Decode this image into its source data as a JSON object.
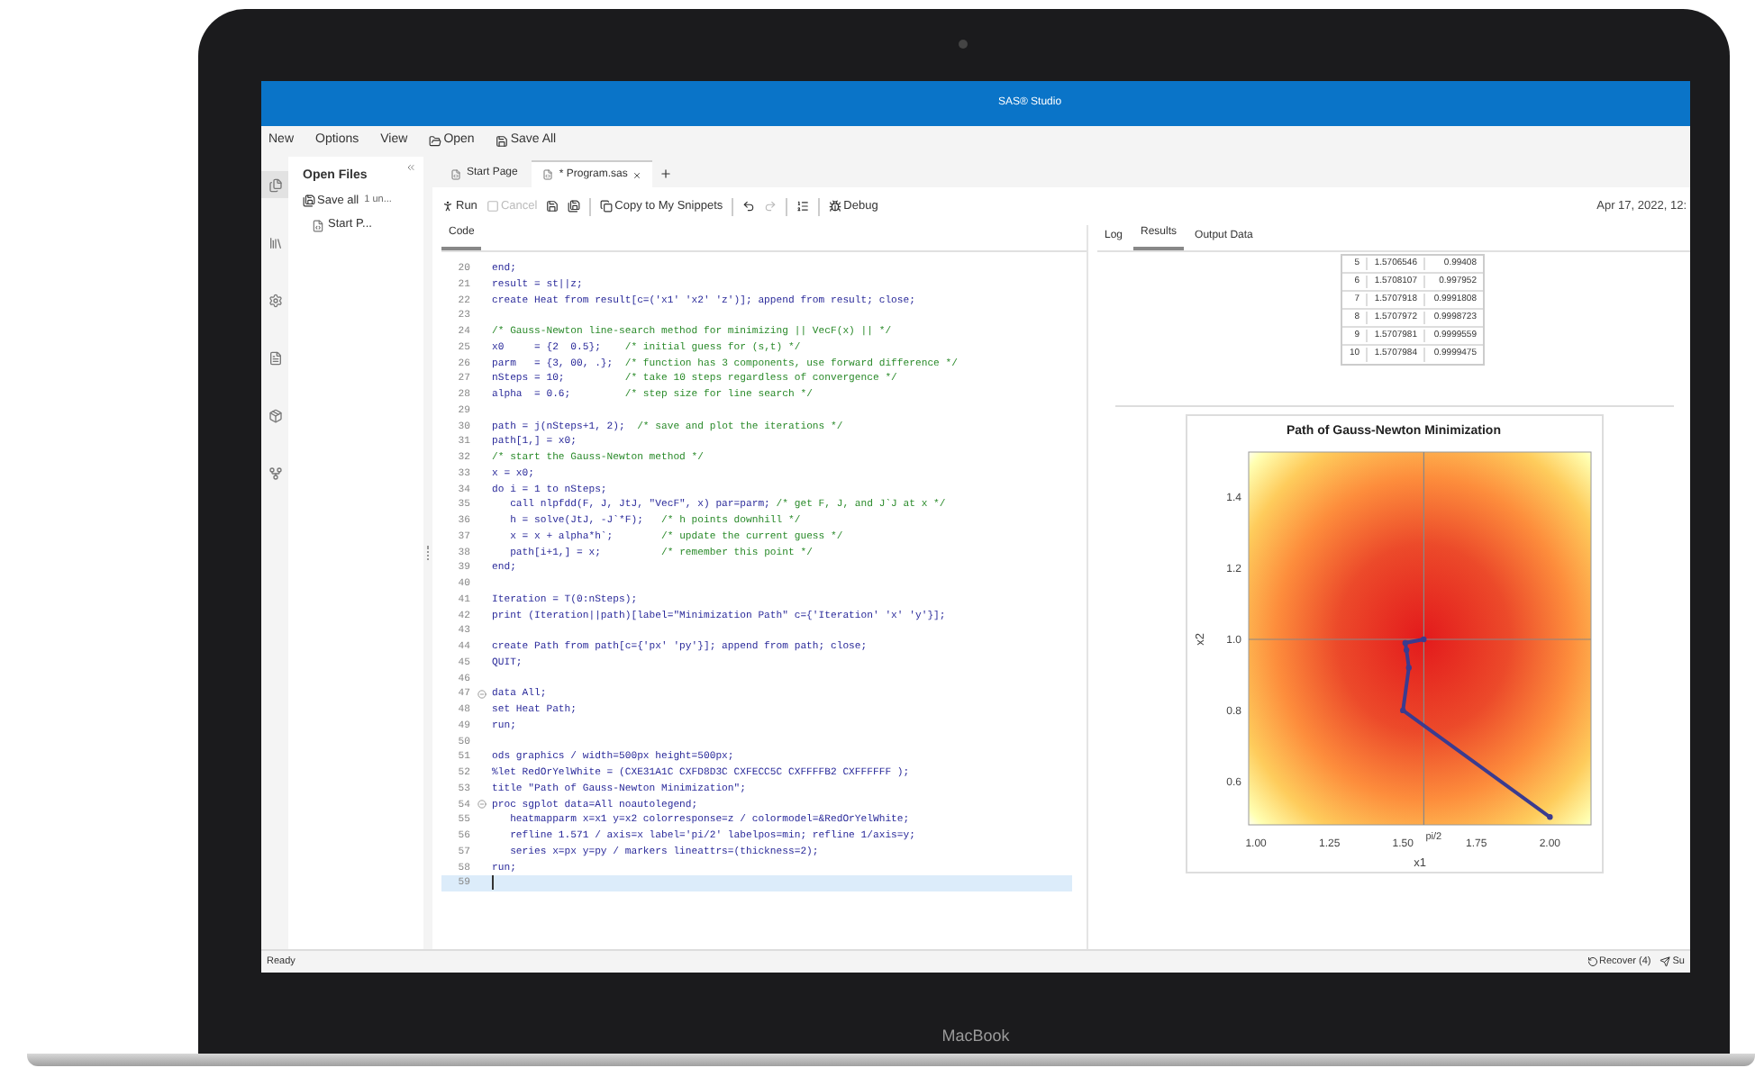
{
  "device": {
    "label": "MacBook"
  },
  "window": {
    "title": "SAS® Studio"
  },
  "menu": [
    "New",
    "Options",
    "View",
    "Open",
    "Save All"
  ],
  "rail": [
    {
      "selected": true
    },
    {
      "selected": false
    },
    {
      "selected": false
    },
    {
      "selected": false
    },
    {
      "selected": false
    },
    {
      "selected": false
    }
  ],
  "open_files": {
    "title": "Open Files",
    "save_all": "Save all",
    "unsaved": "1 un...",
    "items": [
      "Start P..."
    ]
  },
  "tabs": [
    {
      "label": "Start Page",
      "selected": false,
      "closable": false
    },
    {
      "label": "* Program.sas",
      "selected": true,
      "closable": true
    }
  ],
  "toolbar": [
    {
      "kind": "button",
      "label": "Run",
      "disabled": false
    },
    {
      "kind": "button",
      "label": "Cancel",
      "disabled": true
    },
    {
      "kind": "button",
      "disabled": false
    },
    {
      "kind": "button",
      "disabled": false
    },
    {
      "kind": "separator"
    },
    {
      "kind": "button",
      "label": "Copy to My Snippets",
      "disabled": false
    },
    {
      "kind": "separator"
    },
    {
      "kind": "button",
      "disabled": false
    },
    {
      "kind": "button",
      "disabled": true
    },
    {
      "kind": "separator"
    },
    {
      "kind": "button",
      "disabled": false
    },
    {
      "kind": "separator"
    },
    {
      "kind": "button",
      "label": "Debug",
      "disabled": false
    }
  ],
  "timestamp": "Apr 17, 2022, 12:",
  "code_tabs": [
    {
      "label": "Code",
      "selected": true
    }
  ],
  "code": [
    {
      "number": "20",
      "code": "end;"
    },
    {
      "number": "21",
      "code": "result = st||z;"
    },
    {
      "number": "22",
      "code": "create Heat from result[c=('x1' 'x2' 'z')]; append from result; close;"
    },
    {
      "number": "23"
    },
    {
      "number": "24",
      "comment": "/* Gauss-Newton line-search method for minimizing || VecF(x) || */"
    },
    {
      "number": "25",
      "code": "x0     = {2  0.5};    ",
      "comment": "/* initial guess for (s,t) */"
    },
    {
      "number": "26",
      "code": "parm   = {3, 00, .};  ",
      "comment": "/* function has 3 components, use forward difference */"
    },
    {
      "number": "27",
      "code": "nSteps = 10;          ",
      "comment": "/* take 10 steps regardless of convergence */"
    },
    {
      "number": "28",
      "code": "alpha  = 0.6;         ",
      "comment": "/* step size for line search */"
    },
    {
      "number": "29"
    },
    {
      "number": "30",
      "code": "path = j(nSteps+1, 2);  ",
      "comment": "/* save and plot the iterations */"
    },
    {
      "number": "31",
      "code": "path[1,] = x0;"
    },
    {
      "number": "32",
      "comment": "/* start the Gauss-Newton method */"
    },
    {
      "number": "33",
      "code": "x = x0;"
    },
    {
      "number": "34",
      "code": "do i = 1 to nSteps;"
    },
    {
      "number": "35",
      "code": "   call nlpfdd(F, J, JtJ, \"VecF\", x) par=parm; ",
      "comment": "/* get F, J, and J`J at x */"
    },
    {
      "number": "36",
      "code": "   h = solve(JtJ, -J`*F);   ",
      "comment": "/* h points downhill */"
    },
    {
      "number": "37",
      "code": "   x = x + alpha*h`;        ",
      "comment": "/* update the current guess */"
    },
    {
      "number": "38",
      "code": "   path[i+1,] = x;          ",
      "comment": "/* remember this point */"
    },
    {
      "number": "39",
      "code": "end;"
    },
    {
      "number": "40"
    },
    {
      "number": "41",
      "code": "Iteration = T(0:nSteps);"
    },
    {
      "number": "42",
      "code": "print (Iteration||path)[label=\"Minimization Path\" c={'Iteration' 'x' 'y'}];"
    },
    {
      "number": "43"
    },
    {
      "number": "44",
      "code": "create Path from path[c={'px' 'py'}]; append from path; close;"
    },
    {
      "number": "45",
      "code": "QUIT;"
    },
    {
      "number": "46"
    },
    {
      "number": "47",
      "code": "data All;",
      "expanded": true
    },
    {
      "number": "48",
      "code": "set Heat Path;"
    },
    {
      "number": "49",
      "code": "run;"
    },
    {
      "number": "50"
    },
    {
      "number": "51",
      "code": "ods graphics / width=500px height=500px;"
    },
    {
      "number": "52",
      "code": "%let RedOrYelWhite = (CXE31A1C CXFD8D3C CXFECC5C CXFFFFB2 CXFFFFFF );"
    },
    {
      "number": "53",
      "code": "title \"Path of Gauss-Newton Minimization\";"
    },
    {
      "number": "54",
      "code": "proc sgplot data=All noautolegend;",
      "expanded": true
    },
    {
      "number": "55",
      "code": "   heatmapparm x=x1 y=x2 colorresponse=z / colormodel=&RedOrYelWhite;"
    },
    {
      "number": "56",
      "code": "   refline 1.571 / axis=x label='pi/2' labelpos=min; refline 1/axis=y;"
    },
    {
      "number": "57",
      "code": "   series x=px y=py / markers lineattrs=(thickness=2);"
    },
    {
      "number": "58",
      "code": "run;"
    },
    {
      "number": "59",
      "current": true
    }
  ],
  "result_tabs": [
    {
      "label": "Log",
      "selected": false
    },
    {
      "label": "Results",
      "selected": true
    },
    {
      "label": "Output Data",
      "selected": false
    }
  ],
  "results_table": {
    "rows": [
      [
        "5",
        "1.5706546",
        "0.99408"
      ],
      [
        "6",
        "1.5708107",
        "0.997952"
      ],
      [
        "7",
        "1.5707918",
        "0.9991808"
      ],
      [
        "8",
        "1.5707972",
        "0.9998723"
      ],
      [
        "9",
        "1.5707981",
        "0.9999559"
      ],
      [
        "10",
        "1.5707984",
        "0.9999475"
      ]
    ]
  },
  "chart": {
    "chart_data": {
      "type": "line",
      "title": "Path of Gauss-Newton Minimization",
      "xlabel": "x1",
      "ylabel": "x2",
      "xlim": [
        0.975,
        2.14
      ],
      "ylim": [
        0.478,
        1.527
      ],
      "xticks": [
        {
          "value": 1,
          "label": "1.00"
        },
        {
          "value": 1.25,
          "label": "1.25"
        },
        {
          "value": 1.5,
          "label": "1.50"
        },
        {
          "value": 1.75,
          "label": "1.75"
        },
        {
          "value": 2,
          "label": "2.00"
        }
      ],
      "yticks": [
        0.6,
        0.8,
        {
          "value": 1,
          "label": "1.0"
        },
        1.2,
        1.4
      ],
      "x": [
        2.0,
        1.5,
        1.52,
        1.512,
        1.508,
        1.5707
      ],
      "series": [
        {
          "color": "#3b3b8f",
          "marker": "circle",
          "values": [
            0.5,
            0.8,
            0.92,
            0.97,
            0.99,
            1.0
          ]
        }
      ],
      "ref_lines": [
        {
          "axis": "x",
          "value": 1.571,
          "label": "pi/2"
        },
        {
          "axis": "y",
          "value": 1.0
        }
      ]
    }
  },
  "status_bar": {
    "text": "Ready",
    "items": [
      "Recover (4)",
      "Su"
    ]
  }
}
